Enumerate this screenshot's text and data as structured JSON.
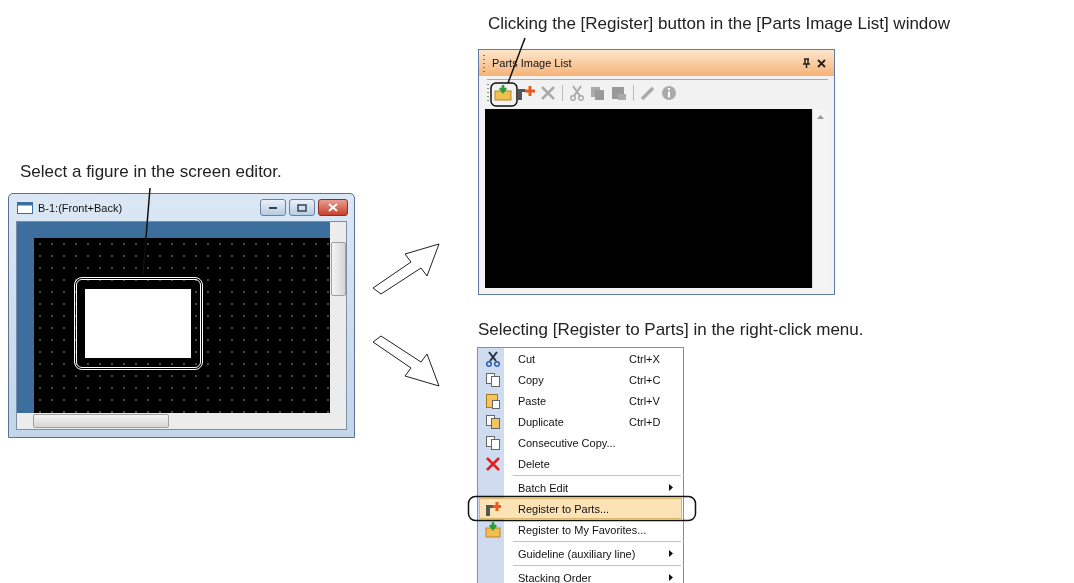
{
  "editor_caption": "Select a figure in the screen editor.",
  "editor_window": {
    "title": "B-1:(Front+Back)"
  },
  "toolbar_caption": "Clicking the [Register] button in the [Parts Image List] window",
  "parts_window": {
    "title": "Parts Image List"
  },
  "menu_caption": "Selecting [Register to Parts] in the right-click menu.",
  "context_menu": {
    "items": [
      {
        "label": "Cut",
        "shortcut": "Ctrl+X",
        "submenu": false,
        "selected": false,
        "group_start": false
      },
      {
        "label": "Copy",
        "shortcut": "Ctrl+C",
        "submenu": false,
        "selected": false,
        "group_start": false
      },
      {
        "label": "Paste",
        "shortcut": "Ctrl+V",
        "submenu": false,
        "selected": false,
        "group_start": false
      },
      {
        "label": "Duplicate",
        "shortcut": "Ctrl+D",
        "submenu": false,
        "selected": false,
        "group_start": false
      },
      {
        "label": "Consecutive Copy...",
        "submenu": false,
        "selected": false,
        "group_start": false
      },
      {
        "label": "Delete",
        "submenu": false,
        "selected": false,
        "group_start": false
      },
      {
        "label": "Batch Edit",
        "submenu": true,
        "selected": false,
        "group_start": true
      },
      {
        "label": "Register to Parts...",
        "submenu": false,
        "selected": true,
        "group_start": false
      },
      {
        "label": "Register to My Favorites...",
        "submenu": false,
        "selected": false,
        "group_start": false
      },
      {
        "label": "Guideline (auxiliary line)",
        "submenu": true,
        "selected": false,
        "group_start": true
      },
      {
        "label": "Stacking Order",
        "submenu": true,
        "selected": false,
        "group_start": true
      }
    ]
  }
}
